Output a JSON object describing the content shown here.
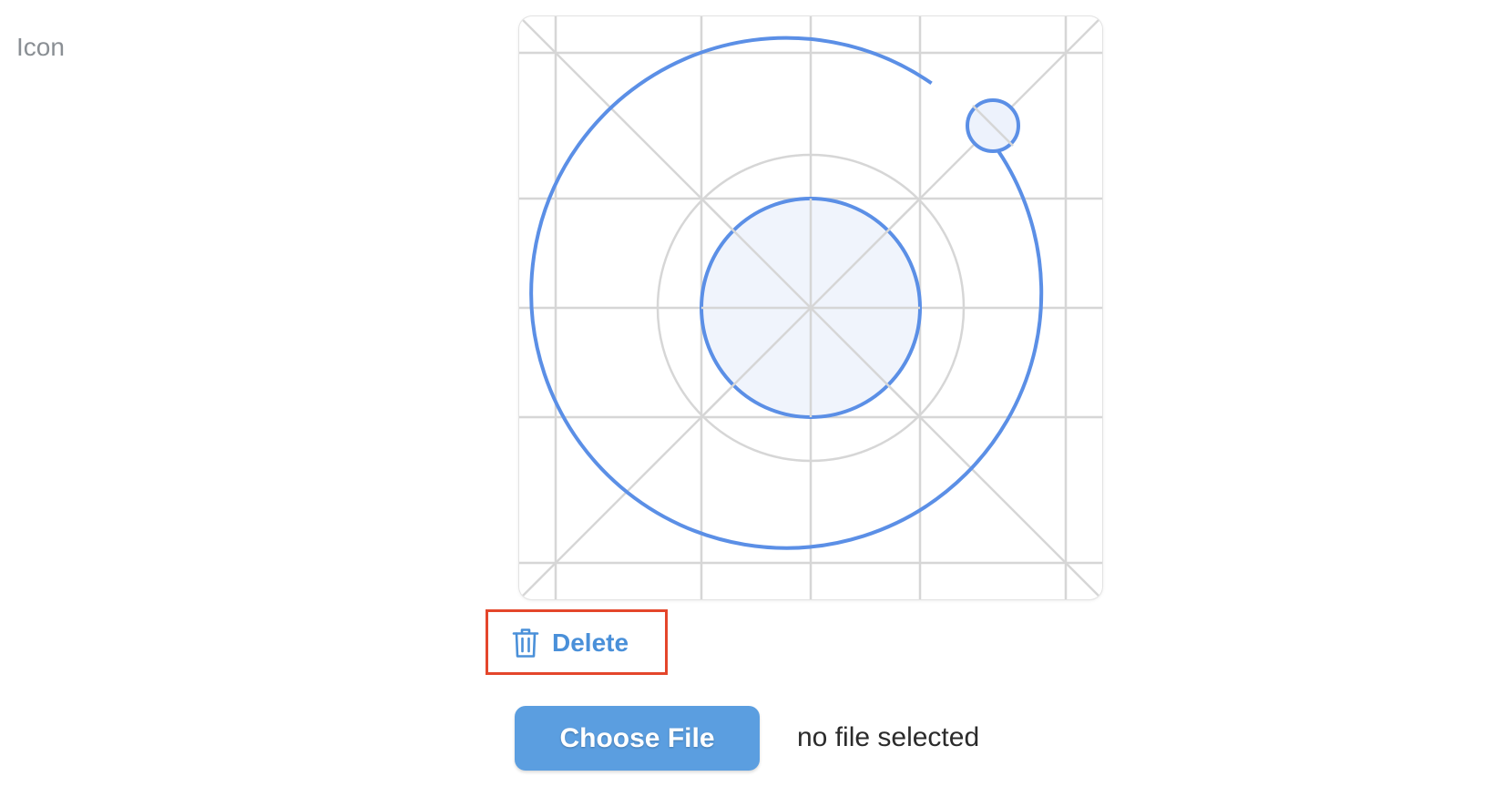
{
  "field": {
    "label": "Icon"
  },
  "icon_preview": {
    "icon": "icon-grid-template",
    "grid_color": "#d6d6d6",
    "accent_color": "#5b8fe6",
    "fill_color": "#edf2fc"
  },
  "delete": {
    "label": "Delete",
    "icon": "trash-icon",
    "color": "#4a90d9",
    "highlight_color": "#e4462b"
  },
  "file_input": {
    "button_label": "Choose File",
    "status_text": "no file selected",
    "button_color": "#5b9ee0"
  }
}
